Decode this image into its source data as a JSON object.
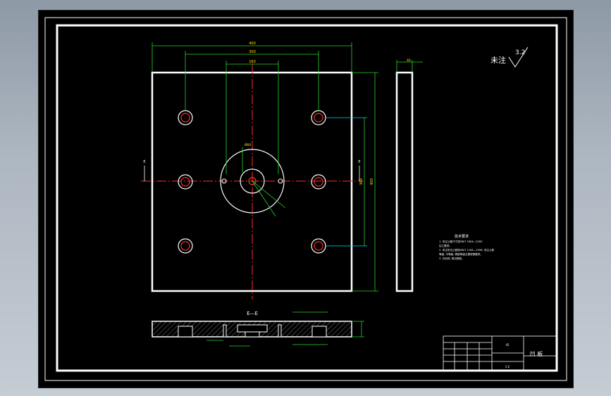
{
  "drawing": {
    "title": "凹 板",
    "roughness_note": "未注",
    "roughness_value": "3.2",
    "section_label": "E—E",
    "cut_mark_left": "E",
    "cut_mark_right": "E",
    "dim_overall_width": "400",
    "dim_hole_span_outer": "300",
    "dim_hole_span_inner": "160",
    "dim_center_bore": "Ø60",
    "dim_height": "360",
    "dim_height_side": "400",
    "dim_thickness": "40"
  },
  "technical_requirements": {
    "heading": "技术要求",
    "lines": [
      "1. 未注公差尺寸按GB/T 1804—2000",
      "   加工要求。",
      "2. 未注形位公差按GB/T 1184—1996, 未注公差",
      "   等级, 中等级, 精度等级主要按照要求。",
      "3. 去毛刺, 锐边倒钝。"
    ]
  },
  "title_block": {
    "part_name": "凹 板",
    "scale": "1:2",
    "material": "45"
  },
  "colors": {
    "outline": "#ffffff",
    "dimension": "#2bd32b",
    "centerline": "#ff2a2a",
    "text": "#ffe000",
    "leader": "#00d8ff",
    "hatch": "#c8c8c8"
  }
}
